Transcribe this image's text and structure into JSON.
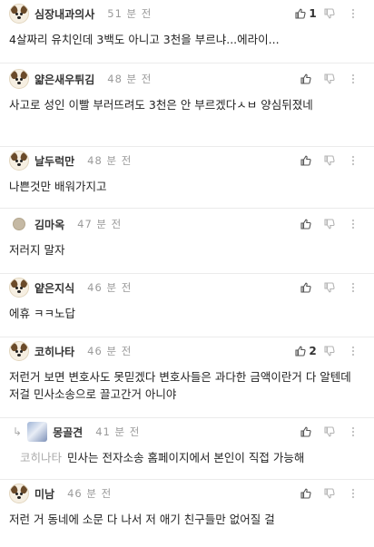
{
  "comments": [
    {
      "nick": "심장내과의사",
      "time": "51 분 전",
      "likes": "1",
      "text": "4살짜리 유치인데 3백도 아니고 3천을 부르냐...에라이..."
    },
    {
      "nick": "얇은새우튀김",
      "time": "48 분 전",
      "likes": "",
      "text": "사고로 성인 이빨 부러뜨려도 3천은 안 부르겠다ㅅㅂ 양심뒤졌네"
    },
    {
      "nick": "날두럭만",
      "time": "48 분 전",
      "likes": "",
      "text": "나쁜것만 배워가지고"
    },
    {
      "nick": "김마옥",
      "time": "47 분 전",
      "likes": "",
      "text": "저러지 말자"
    },
    {
      "nick": "얕은지식",
      "time": "46 분 전",
      "likes": "",
      "text": "에휴 ㅋㅋ노답"
    },
    {
      "nick": "코히나타",
      "time": "46 분 전",
      "likes": "2",
      "text": "저런거 보면 변호사도 못믿겠다 변호사들은 과다한 금액이란거 다 알텐데 저걸 민사소송으로 끌고간거 아니야"
    },
    {
      "nick": "몽골견",
      "time": "41 분 전",
      "likes": "",
      "reply_to": "코히나타",
      "text": "민사는 전자소송 홈페이지에서 본인이 직접 가능해"
    },
    {
      "nick": "미남",
      "time": "46 분 전",
      "likes": "",
      "text": "저런 거 동네에 소문 다 나서 저 애기 친구들만 없어질 걸"
    }
  ],
  "icons": {
    "like": "thumbs-up-icon",
    "dislike": "thumbs-down-icon",
    "more": "more-vertical-icon",
    "reply": "reply-arrow-icon"
  }
}
